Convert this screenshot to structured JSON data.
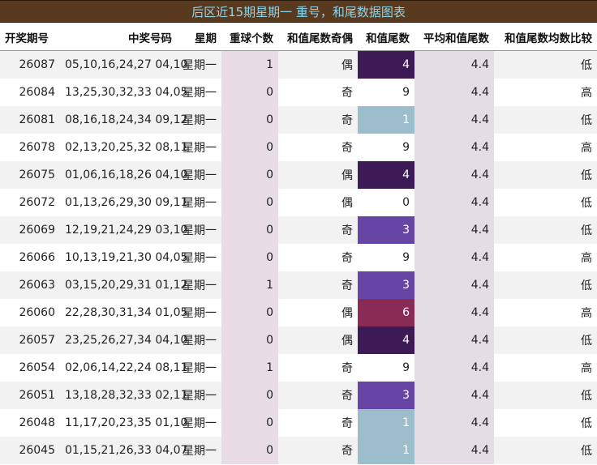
{
  "title": "后区近15期星期一  重号，和尾数据图表",
  "headers": [
    "开奖期号",
    "中奖号码",
    "星期",
    "重球个数",
    "和值尾数奇偶",
    "和值尾数",
    "平均和值尾数",
    "和值尾数均数比较"
  ],
  "tail_colors": {
    "0": "",
    "1": "#9bbdcc",
    "3": "#6645a5",
    "4": "#3c1a55",
    "6": "#8a2b55",
    "9": ""
  },
  "rows": [
    {
      "issue": "26087",
      "numbers": "05,10,16,24,27 04,10",
      "weekday": "星期一",
      "repeat": "1",
      "parity": "偶",
      "tail": "4",
      "avg": "4.4",
      "compare": "低"
    },
    {
      "issue": "26084",
      "numbers": "13,25,30,32,33 04,05",
      "weekday": "星期一",
      "repeat": "0",
      "parity": "奇",
      "tail": "9",
      "avg": "4.4",
      "compare": "高"
    },
    {
      "issue": "26081",
      "numbers": "08,16,18,24,34 09,12",
      "weekday": "星期一",
      "repeat": "0",
      "parity": "奇",
      "tail": "1",
      "avg": "4.4",
      "compare": "低"
    },
    {
      "issue": "26078",
      "numbers": "02,13,20,25,32 08,11",
      "weekday": "星期一",
      "repeat": "0",
      "parity": "奇",
      "tail": "9",
      "avg": "4.4",
      "compare": "高"
    },
    {
      "issue": "26075",
      "numbers": "01,06,16,18,26 04,10",
      "weekday": "星期一",
      "repeat": "0",
      "parity": "偶",
      "tail": "4",
      "avg": "4.4",
      "compare": "低"
    },
    {
      "issue": "26072",
      "numbers": "01,13,26,29,30 09,11",
      "weekday": "星期一",
      "repeat": "0",
      "parity": "偶",
      "tail": "0",
      "avg": "4.4",
      "compare": "低"
    },
    {
      "issue": "26069",
      "numbers": "12,19,21,24,29 03,10",
      "weekday": "星期一",
      "repeat": "0",
      "parity": "奇",
      "tail": "3",
      "avg": "4.4",
      "compare": "低"
    },
    {
      "issue": "26066",
      "numbers": "10,13,19,21,30 04,05",
      "weekday": "星期一",
      "repeat": "0",
      "parity": "奇",
      "tail": "9",
      "avg": "4.4",
      "compare": "高"
    },
    {
      "issue": "26063",
      "numbers": "03,15,20,29,31 01,12",
      "weekday": "星期一",
      "repeat": "1",
      "parity": "奇",
      "tail": "3",
      "avg": "4.4",
      "compare": "低"
    },
    {
      "issue": "26060",
      "numbers": "22,28,30,31,34 01,05",
      "weekday": "星期一",
      "repeat": "0",
      "parity": "偶",
      "tail": "6",
      "avg": "4.4",
      "compare": "高"
    },
    {
      "issue": "26057",
      "numbers": "23,25,26,27,34 04,10",
      "weekday": "星期一",
      "repeat": "0",
      "parity": "偶",
      "tail": "4",
      "avg": "4.4",
      "compare": "低"
    },
    {
      "issue": "26054",
      "numbers": "02,06,14,22,24 08,11",
      "weekday": "星期一",
      "repeat": "1",
      "parity": "奇",
      "tail": "9",
      "avg": "4.4",
      "compare": "高"
    },
    {
      "issue": "26051",
      "numbers": "13,18,28,32,33 02,11",
      "weekday": "星期一",
      "repeat": "0",
      "parity": "奇",
      "tail": "3",
      "avg": "4.4",
      "compare": "低"
    },
    {
      "issue": "26048",
      "numbers": "11,17,20,23,35 01,10",
      "weekday": "星期一",
      "repeat": "0",
      "parity": "奇",
      "tail": "1",
      "avg": "4.4",
      "compare": "低"
    },
    {
      "issue": "26045",
      "numbers": "01,15,21,26,33 04,07",
      "weekday": "星期一",
      "repeat": "0",
      "parity": "奇",
      "tail": "1",
      "avg": "4.4",
      "compare": "低"
    }
  ]
}
